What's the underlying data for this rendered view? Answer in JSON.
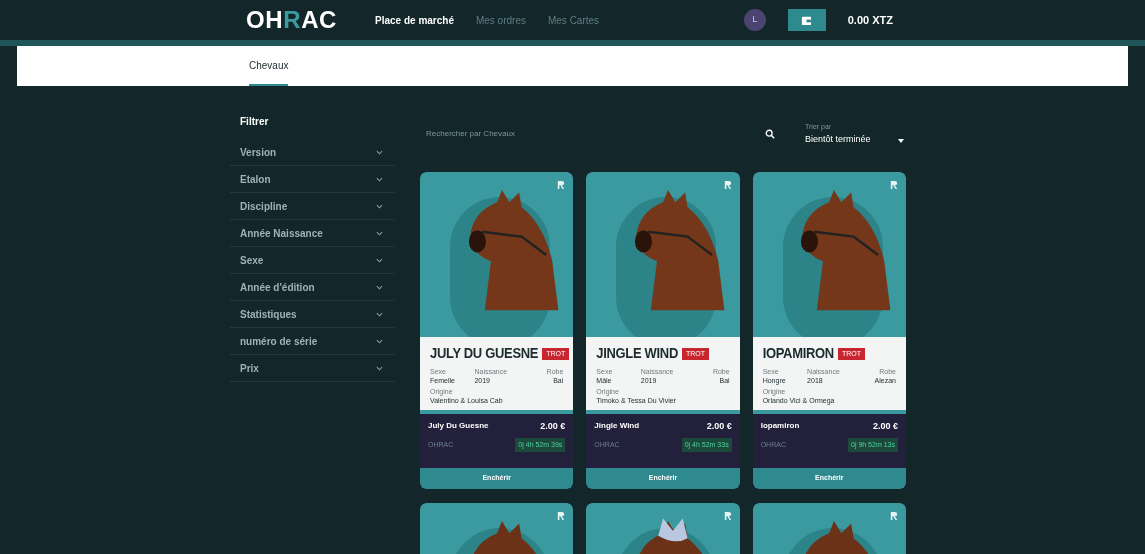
{
  "nav": {
    "logo": [
      {
        "text": "OH",
        "accent": false
      },
      {
        "text": "R",
        "accent": true
      },
      {
        "text": "AC",
        "accent": false
      }
    ],
    "links": [
      {
        "label": "Place de marché",
        "selected": true
      },
      {
        "label": "Mes ordres",
        "selected": false
      },
      {
        "label": "Mes Cartes",
        "selected": false
      }
    ],
    "avatar": "L",
    "balance": "0.00 XTZ"
  },
  "subtabs": [
    {
      "label": "Chevaux",
      "selected": true
    }
  ],
  "filters": {
    "title": "Filtrer",
    "items": [
      {
        "label": "Version",
        "expanded": false
      },
      {
        "label": "Etalon",
        "expanded": false
      },
      {
        "label": "Discipline",
        "expanded": false
      },
      {
        "label": "Année Naissance",
        "expanded": false
      },
      {
        "label": "Sexe",
        "expanded": false
      },
      {
        "label": "Année d'édition",
        "expanded": false
      },
      {
        "label": "Statistiques",
        "expanded": false
      },
      {
        "label": "numéro de série",
        "expanded": false
      },
      {
        "label": "Prix",
        "expanded": false
      }
    ]
  },
  "search": {
    "placeholder": "Rechercher par Chevaux"
  },
  "sort": {
    "label": "Trier par",
    "value": "Bientôt terminée"
  },
  "cards": [
    {
      "title": "JULY DU GUESNE",
      "badge": "TROT",
      "fields": [
        {
          "label": "Sexe",
          "value": "Femelle"
        },
        {
          "label": "Naissance",
          "value": "2019"
        },
        {
          "label": "Robe",
          "value": "Bai"
        }
      ],
      "origin_label": "Origine",
      "origin": "Valentino & Louisa Cab",
      "name": "July Du Guesne",
      "price": "2.00 €",
      "brand": "OHRAC",
      "timer": "0j 4h 52m 39s",
      "button": "Enchérir"
    },
    {
      "title": "JINGLE WIND",
      "badge": "TROT",
      "fields": [
        {
          "label": "Sexe",
          "value": "Mâle"
        },
        {
          "label": "Naissance",
          "value": "2019"
        },
        {
          "label": "Robe",
          "value": "Bai"
        }
      ],
      "origin_label": "Origine",
      "origin": "Timoko & Tessa Du Vivier",
      "name": "Jingle Wind",
      "price": "2.00 €",
      "brand": "OHRAC",
      "timer": "0j 4h 52m 33s",
      "button": "Enchérir"
    },
    {
      "title": "IOPAMIRON",
      "badge": "TROT",
      "fields": [
        {
          "label": "Sexe",
          "value": "Hongre"
        },
        {
          "label": "Naissance",
          "value": "2018"
        },
        {
          "label": "Robe",
          "value": "Alezan"
        }
      ],
      "origin_label": "Origine",
      "origin": "Orlando Vici & Ormega",
      "name": "Iopamiron",
      "price": "2.00 €",
      "brand": "OHRAC",
      "timer": "0j 9h 52m 13s",
      "button": "Enchérir"
    }
  ]
}
